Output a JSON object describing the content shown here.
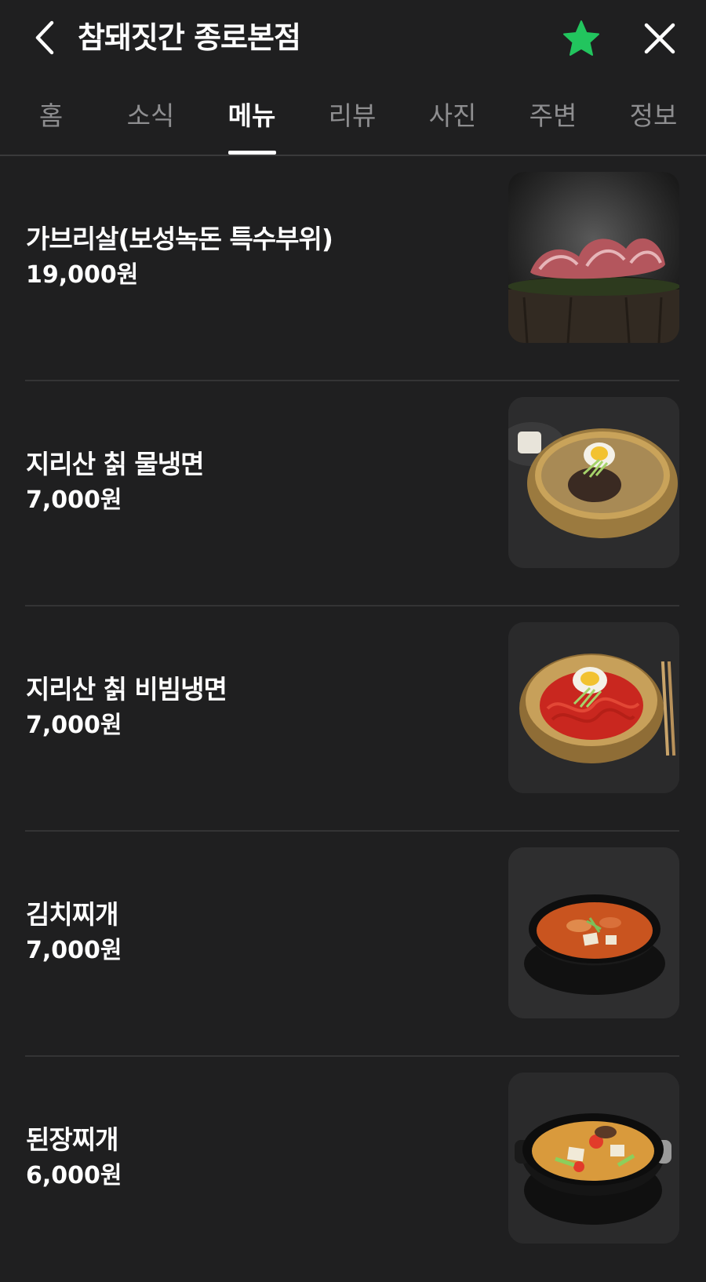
{
  "header": {
    "title": "참돼짓간 종로본점",
    "back_icon": "chevron-left-icon",
    "favorite_icon": "star-icon",
    "favorite_color": "#22c55e",
    "close_icon": "close-icon"
  },
  "tabs": [
    {
      "label": "홈",
      "active": false
    },
    {
      "label": "소식",
      "active": false
    },
    {
      "label": "메뉴",
      "active": true
    },
    {
      "label": "리뷰",
      "active": false
    },
    {
      "label": "사진",
      "active": false
    },
    {
      "label": "주변",
      "active": false
    },
    {
      "label": "정보",
      "active": false
    }
  ],
  "menu": [
    {
      "name": "가브리살(보성녹돈 특수부위)",
      "price": "19,000원",
      "photo": "grilled-pork-photo"
    },
    {
      "name": "지리산 칡 물냉면",
      "price": "7,000원",
      "photo": "cold-noodle-photo"
    },
    {
      "name": "지리산 칡 비빔냉면",
      "price": "7,000원",
      "photo": "spicy-noodle-photo"
    },
    {
      "name": "김치찌개",
      "price": "7,000원",
      "photo": "kimchi-stew-photo"
    },
    {
      "name": "된장찌개",
      "price": "6,000원",
      "photo": "soybean-stew-photo"
    }
  ],
  "colors": {
    "background": "#1f1f20",
    "text": "#ffffff",
    "tab_inactive": "#8e8e90",
    "divider": "#343435"
  }
}
